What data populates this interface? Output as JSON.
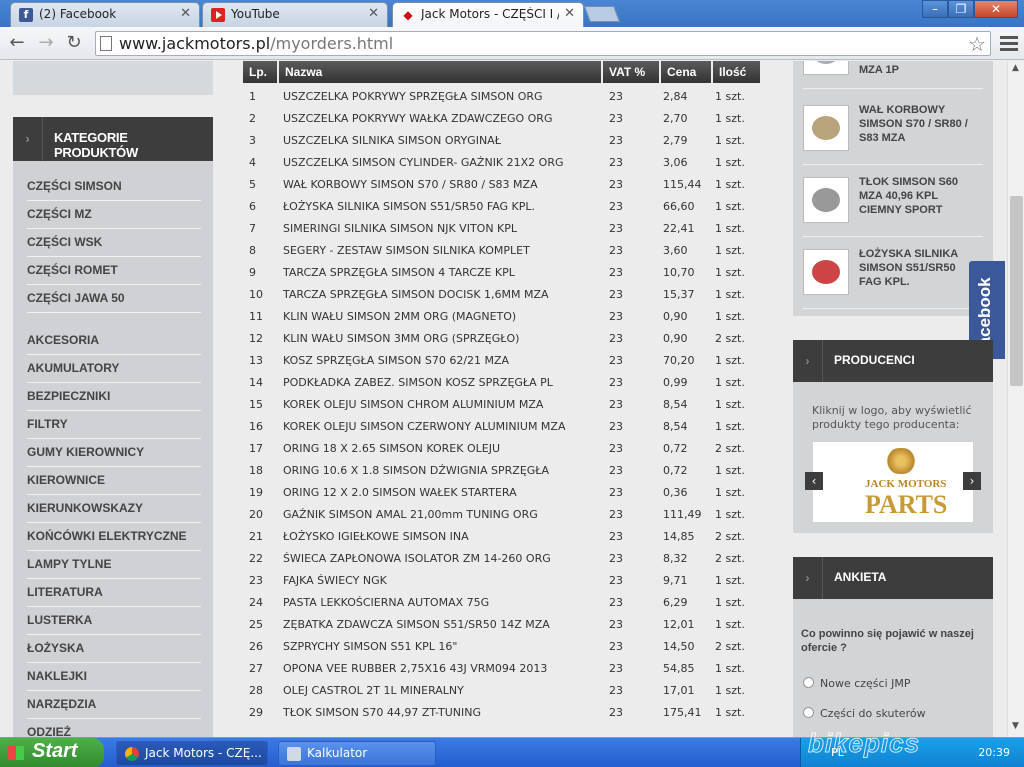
{
  "browser": {
    "tabs": [
      {
        "title": "(2) Facebook",
        "icon": "facebook-icon"
      },
      {
        "title": "YouTube",
        "icon": "youtube-icon"
      },
      {
        "title": "Jack Motors - CZĘŚCI I /",
        "icon": "motorcycle-icon"
      }
    ],
    "url_host": "www.jackmotors.pl",
    "url_path": "/myorders.html"
  },
  "left": {
    "categories_title": "KATEGORIE PRODUKTÓW",
    "categories": [
      "CZĘŚCI SIMSON",
      "CZĘŚCI MZ",
      "CZĘŚCI WSK",
      "CZĘŚCI ROMET",
      "CZĘŚCI JAWA 50",
      "AKCESORIA",
      "AKUMULATORY",
      "BEZPIECZNIKI",
      "FILTRY",
      "GUMY KIEROWNICY",
      "KIEROWNICE",
      "KIERUNKOWSKAZY",
      "KOŃCÓWKI ELEKTRYCZNE",
      "LAMPY TYLNE",
      "LITERATURA",
      "LUSTERKA",
      "ŁOŻYSKA",
      "NAKLEJKI",
      "NARZĘDZIA",
      "ODZIEŻ"
    ]
  },
  "orders": {
    "headers": [
      "Lp.",
      "Nazwa",
      "VAT %",
      "Cena",
      "Ilość"
    ],
    "rows": [
      [
        "1",
        "USZCZELKA POKRYWY SPRZĘGŁA SIMSON ORG",
        "23",
        "2,84",
        "1 szt."
      ],
      [
        "2",
        "USZCZELKA POKRYWY WAŁKA ZDAWCZEGO ORG",
        "23",
        "2,70",
        "1 szt."
      ],
      [
        "3",
        "USZCZELKA SILNIKA SIMSON ORYGINAŁ",
        "23",
        "2,79",
        "1 szt."
      ],
      [
        "4",
        "USZCZELKA SIMSON CYLINDER- GAŹNIK 21X2 ORG",
        "23",
        "3,06",
        "1 szt."
      ],
      [
        "5",
        "WAŁ KORBOWY SIMSON S70 / SR80 / S83 MZA",
        "23",
        "115,44",
        "1 szt."
      ],
      [
        "6",
        "ŁOŻYSKA SILNIKA SIMSON S51/SR50 FAG KPL.",
        "23",
        "66,60",
        "1 szt."
      ],
      [
        "7",
        "SIMERINGI SILNIKA SIMSON NJK VITON KPL",
        "23",
        "22,41",
        "1 szt."
      ],
      [
        "8",
        "SEGERY - ZESTAW SIMSON SILNIKA KOMPLET",
        "23",
        "3,60",
        "1 szt."
      ],
      [
        "9",
        "TARCZA SPRZĘGŁA SIMSON 4 TARCZE KPL",
        "23",
        "10,70",
        "1 szt."
      ],
      [
        "10",
        "TARCZA SPRZĘGŁA SIMSON DOCISK 1,6MM MZA",
        "23",
        "15,37",
        "1 szt."
      ],
      [
        "11",
        "KLIN WAŁU SIMSON 2MM ORG (MAGNETO)",
        "23",
        "0,90",
        "1 szt."
      ],
      [
        "12",
        "KLIN WAŁU SIMSON 3MM ORG (SPRZĘGŁO)",
        "23",
        "0,90",
        "2 szt."
      ],
      [
        "13",
        "KOSZ SPRZĘGŁA SIMSON S70 62/21 MZA",
        "23",
        "70,20",
        "1 szt."
      ],
      [
        "14",
        "PODKŁADKA ZABEZ. SIMSON KOSZ SPRZĘGŁA PL",
        "23",
        "0,99",
        "1 szt."
      ],
      [
        "15",
        "KOREK OLEJU SIMSON CHROM ALUMINIUM MZA",
        "23",
        "8,54",
        "1 szt."
      ],
      [
        "16",
        "KOREK OLEJU SIMSON CZERWONY ALUMINIUM MZA",
        "23",
        "8,54",
        "1 szt."
      ],
      [
        "17",
        "ORING 18 X 2.65 SIMSON KOREK OLEJU",
        "23",
        "0,72",
        "2 szt."
      ],
      [
        "18",
        "ORING 10.6 X 1.8 SIMSON DŹWIGNIA SPRZĘGŁA",
        "23",
        "0,72",
        "1 szt."
      ],
      [
        "19",
        "ORING 12 X 2.0 SIMSON WAŁEK STARTERA",
        "23",
        "0,36",
        "1 szt."
      ],
      [
        "20",
        "GAŹNIK SIMSON AMAL 21,00mm TUNING ORG",
        "23",
        "111,49",
        "1 szt."
      ],
      [
        "21",
        "ŁOŻYSKO IGIEŁKOWE SIMSON INA",
        "23",
        "14,85",
        "2 szt."
      ],
      [
        "22",
        "ŚWIECA ZAPŁONOWA ISOLATOR ZM 14-260 ORG",
        "23",
        "8,32",
        "2 szt."
      ],
      [
        "23",
        "FAJKA ŚWIECY NGK",
        "23",
        "9,71",
        "1 szt."
      ],
      [
        "24",
        "PASTA LEKKOŚCIERNA AUTOMAX 75G",
        "23",
        "6,29",
        "1 szt."
      ],
      [
        "25",
        "ZĘBATKA ZDAWCZA SIMSON S51/SR50 14Z MZA",
        "23",
        "12,01",
        "1 szt."
      ],
      [
        "26",
        "SZPRYCHY SIMSON S51 KPL 16\"",
        "23",
        "14,50",
        "2 szt."
      ],
      [
        "27",
        "OPONA VEE RUBBER 2,75X16 43J VRM094 2013",
        "23",
        "54,85",
        "1 szt."
      ],
      [
        "28",
        "OLEJ CASTROL 2T 1L MINERALNY",
        "23",
        "17,01",
        "1 szt."
      ],
      [
        "29",
        "TŁOK SIMSON S70 44,97 ZT-TUNING",
        "23",
        "175,41",
        "1 szt."
      ]
    ]
  },
  "right": {
    "products": [
      {
        "name": "MZA 1P"
      },
      {
        "name": "WAŁ KORBOWY SIMSON S70 / SR80 / S83 MZA"
      },
      {
        "name": "TŁOK SIMSON S60 MZA 40,96 KPL CIEMNY SPORT"
      },
      {
        "name": "ŁOŻYSKA SILNIKA SIMSON S51/SR50 FAG KPL."
      }
    ],
    "facebook_tab": "facebook",
    "producers_title": "PRODUCENCI",
    "producers_note": "Kliknij w logo, aby wyświetlić produkty tego producenta:",
    "logo_line1": "JACK MOTORS",
    "logo_line2": "PARTS",
    "poll_title": "ANKIETA",
    "poll_question": "Co powinno się pojawić w naszej ofercie ?",
    "poll_options": [
      "Nowe części JMP",
      "Części do skuterów"
    ]
  },
  "taskbar": {
    "start": "Start",
    "tasks": [
      "Jack Motors - CZĘ...",
      "Kalkulator"
    ],
    "lang": "PL",
    "clock": "20:39"
  },
  "watermark": "bikepics"
}
